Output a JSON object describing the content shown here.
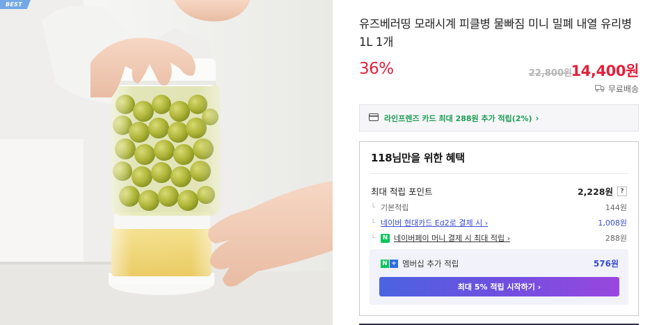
{
  "image": {
    "badge": "BEST"
  },
  "product": {
    "title": "유즈베러띵 모래시계 피클병 물빠짐 미니 밀폐 내열 유리병 1L 1개",
    "discount": "36%",
    "original_price": "22,800원",
    "sale_price": "14,400원",
    "shipping_icon": "truck-icon",
    "shipping": "무료배송"
  },
  "card_promo": {
    "icon": "credit-card-icon",
    "text": "라인프렌즈 카드 최대 288원 추가 적립(2%)",
    "chevron": "›"
  },
  "benefits": {
    "title": "118님만을 위한 혜택",
    "max_points_label": "최대 적립 포인트",
    "max_points_value": "2,228원",
    "help_badge": "?",
    "items": [
      {
        "label": "기본적립",
        "value": "144원"
      },
      {
        "label": "네이버 현대카드 Ed2로 결제 시 ›",
        "value": "1,008원"
      },
      {
        "label": "네이버페이 머니 결제 시 최대 적립 ›",
        "value": "288원"
      }
    ],
    "membership": {
      "label": "멤버십 추가 적립",
      "value": "576원",
      "button": "최대 5% 적립 시작하기 ›"
    }
  },
  "colors": {
    "price_red": "#e1213b",
    "naver_green": "#03c75a",
    "link_blue": "#3a4bd0",
    "promo_green": "#1f9d55"
  }
}
